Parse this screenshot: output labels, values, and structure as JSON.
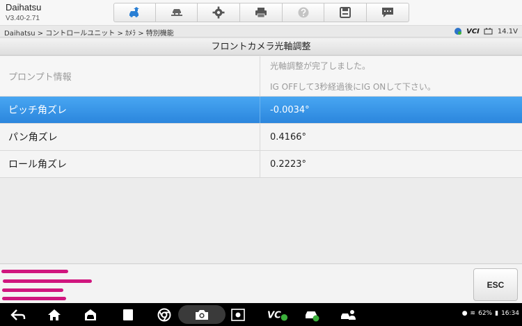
{
  "app": {
    "title": "Daihatsu",
    "version": "V3.40-2.71"
  },
  "toolbar": {
    "buttons": [
      {
        "icon": "car-home-icon"
      },
      {
        "icon": "car-lift-icon"
      },
      {
        "icon": "gear-icon"
      },
      {
        "icon": "printer-icon"
      },
      {
        "icon": "help-icon"
      },
      {
        "icon": "save-icon"
      },
      {
        "icon": "message-icon"
      }
    ]
  },
  "breadcrumb": "Daihatsu > コントロールユニット > ｶﾒﾗ > 特別機能",
  "status": {
    "vci": "VCI",
    "voltage": "14.1V"
  },
  "page_title": "フロントカメラ光軸調整",
  "prompt": {
    "label": "プロンプト情報",
    "line1": "光軸調整が完了しました。",
    "line2": "IG OFFして3秒経過後にIG ONして下さい。"
  },
  "rows": [
    {
      "label": "ピッチ角ズレ",
      "value": "-0.0034°"
    },
    {
      "label": "パン角ズレ",
      "value": "0.4166°"
    },
    {
      "label": "ロール角ズレ",
      "value": "0.2223°"
    }
  ],
  "esc_label": "ESC",
  "system": {
    "battery": "62%",
    "time": "16:34"
  },
  "colors": {
    "selected_row": "#2b86dd",
    "scribble": "#d0167e"
  }
}
